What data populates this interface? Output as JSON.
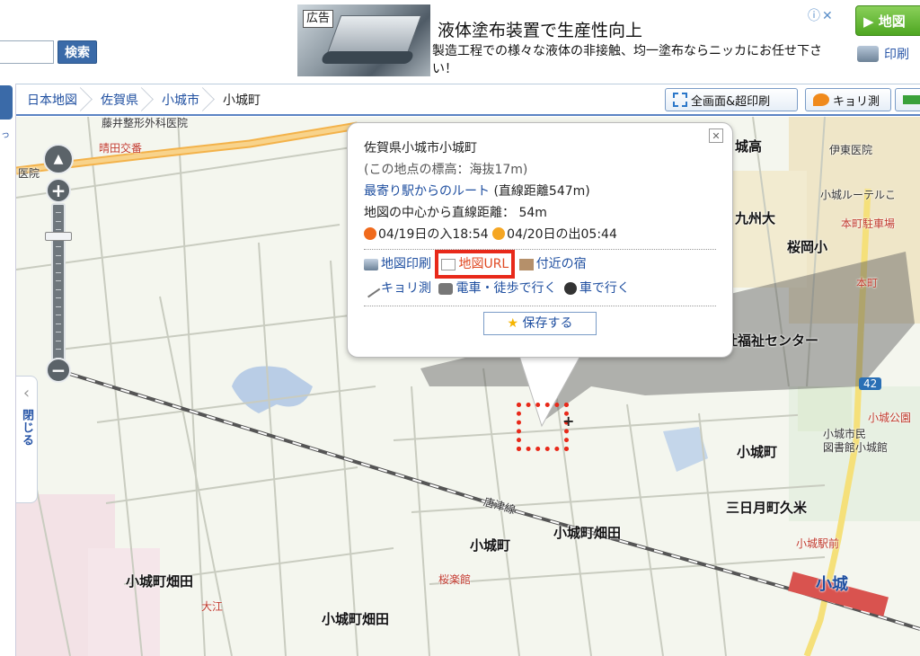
{
  "header": {
    "search_button": "検索",
    "map_button": "▶ 地図",
    "print_link": "印刷"
  },
  "ad": {
    "tag": "広告",
    "title": "液体塗布装置で生産性向上",
    "description": "製造工程での様々な液体の非接触、均一塗布ならニッカにお任せ下さい！",
    "close": "ⓘ✕"
  },
  "breadcrumb": [
    "日本地図",
    "佐賀県",
    "小城市",
    "小城町"
  ],
  "toolbar": {
    "fullscreen": "全画面&超印刷",
    "distance": "キョリ測"
  },
  "left_panel": {
    "text": "っ",
    "close_chevron": "‹",
    "close_label": "閉じる"
  },
  "zoom": {
    "in": "+",
    "out": "−",
    "compass": "▲",
    "level": 0.79
  },
  "popup": {
    "close": "✕",
    "address": "佐賀県小城市小城町",
    "elevation": "(この地点の標高：海抜17m)",
    "route_link": "最寄り駅からのルート",
    "route_distance": " (直線距離547m)",
    "center_distance": "地図の中心から直線距離： 54m",
    "sunset": "04/19日の入18:54",
    "sunrise": "04/20日の出05:44",
    "actions_row1": [
      "地図印刷",
      "地図URL",
      "付近の宿"
    ],
    "actions_row2": [
      "キョリ測",
      "電車・徒歩で行く",
      "車で行く"
    ],
    "save": "保存する"
  },
  "map_labels": {
    "hospital_top": "藤井整形外科医院",
    "police": "晴田交番",
    "clinic_left": "医院",
    "takataka": "城高",
    "ito_clinic": "伊東医院",
    "school1": "小城ルーテルこ",
    "kyushu": "九州大",
    "honmachi_parking": "本町駐車場",
    "sakuraoka": "桜岡小",
    "honmachi": "本町",
    "welfare": "社福祉センター",
    "route42": "42",
    "ogi_park": "小城公園",
    "library": "小城市民\n図書館小城館",
    "ogimachi_right": "小城町",
    "mikazuki": "三日月町久米",
    "ogi_ekimae": "小城駅前",
    "ogi": "小城",
    "karatsu_line": "唐津線",
    "ogimachi_center": "小城町",
    "hatada_center": "小城町畑田",
    "oukakan": "桜楽館",
    "hatada_left": "小城町畑田",
    "oe": "大江",
    "hatada_bottom": "小城町畑田"
  },
  "colors": {
    "accent_blue": "#3a6aa8",
    "highlight_red": "#e8291a",
    "map_bg": "#f4f6ee",
    "railway_red": "#d9534f"
  }
}
